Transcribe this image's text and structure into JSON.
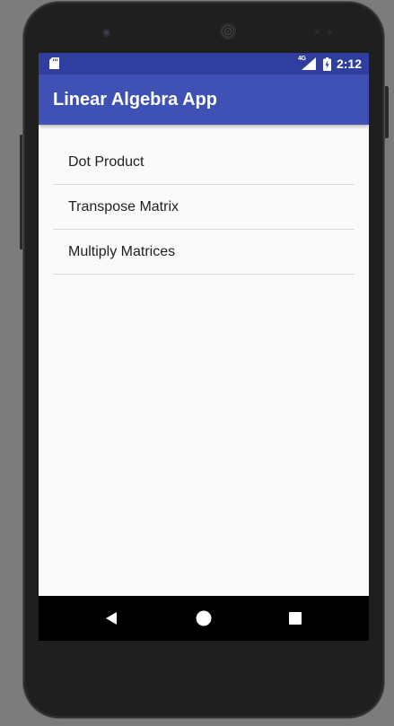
{
  "status_bar": {
    "time": "2:12",
    "network_label": "4G",
    "icons": [
      "sd-card-icon",
      "signal-icon",
      "battery-charging-icon"
    ]
  },
  "app_bar": {
    "title": "Linear Algebra App"
  },
  "menu": {
    "items": [
      {
        "label": "Dot Product"
      },
      {
        "label": "Transpose Matrix"
      },
      {
        "label": "Multiply Matrices"
      }
    ]
  },
  "nav_bar": {
    "buttons": [
      "back-icon",
      "home-icon",
      "recents-icon"
    ]
  },
  "colors": {
    "status_bar": "#303f9f",
    "app_bar": "#3f51b5",
    "background": "#fafafa",
    "divider": "#d9d9d9",
    "text": "#212121"
  }
}
